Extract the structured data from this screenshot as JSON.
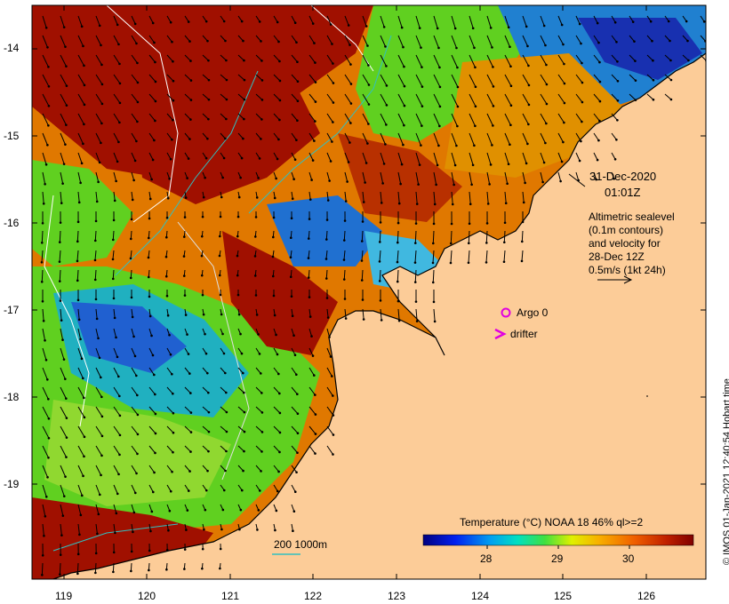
{
  "map": {
    "y_axis_labels": [
      "-14",
      "-15",
      "-16",
      "-17",
      "-18",
      "-19"
    ],
    "x_axis_labels": [
      "119",
      "120",
      "121",
      "122",
      "123",
      "124",
      "125",
      "126"
    ]
  },
  "annotation": {
    "date": "31-Dec-2020",
    "time": "01:01Z",
    "altimetry_lines": [
      "Altimetric sealevel",
      "(0.1m contours)",
      "and velocity for",
      "28-Dec 12Z",
      "0.5m/s (1kt 24h)"
    ]
  },
  "legend": {
    "argo_label": "Argo 0",
    "drifter_label": "drifter",
    "argo_color": "#e000e0",
    "drifter_color": "#e000e0"
  },
  "scale": {
    "label": "200  1000m"
  },
  "colorbar": {
    "title": "Temperature (°C) NOAA 18 46% ql>=2",
    "ticks": [
      "28",
      "29",
      "30"
    ]
  },
  "credit": "© IMOS 01-Jan-2021 12:40:54 Hobart time",
  "colors": {
    "land": "#fccc98",
    "hot": "#a01000",
    "warm": "#e07800",
    "mid": "#60d020",
    "cool": "#20a0e0",
    "cold": "#1830b0"
  }
}
